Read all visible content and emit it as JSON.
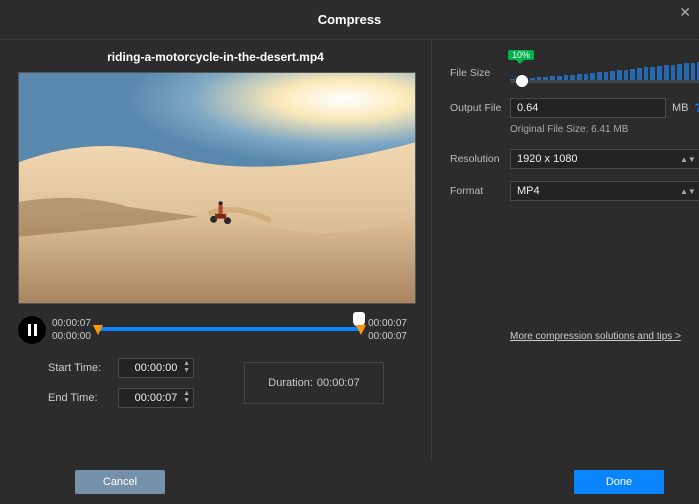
{
  "title": "Compress",
  "filename": "riding-a-motorcycle-in-the-desert.mp4",
  "player": {
    "current": "00:00:07",
    "start_marker": "00:00:00",
    "end_marker": "00:00:07",
    "total": "00:00:07"
  },
  "trim": {
    "start_label": "Start Time:",
    "start_value": "00:00:00",
    "end_label": "End Time:",
    "end_value": "00:00:07",
    "duration_label": "Duration:",
    "duration_value": "00:00:07"
  },
  "settings": {
    "filesize_label": "File Size",
    "filesize_percent": "10%",
    "output_label": "Output File",
    "output_value": "0.64",
    "output_unit": "MB",
    "original_size": "Original File Size: 6.41 MB",
    "resolution_label": "Resolution",
    "resolution_value": "1920 x 1080",
    "format_label": "Format",
    "format_value": "MP4",
    "tips_link": "More compression solutions and tips >"
  },
  "buttons": {
    "cancel": "Cancel",
    "done": "Done"
  }
}
